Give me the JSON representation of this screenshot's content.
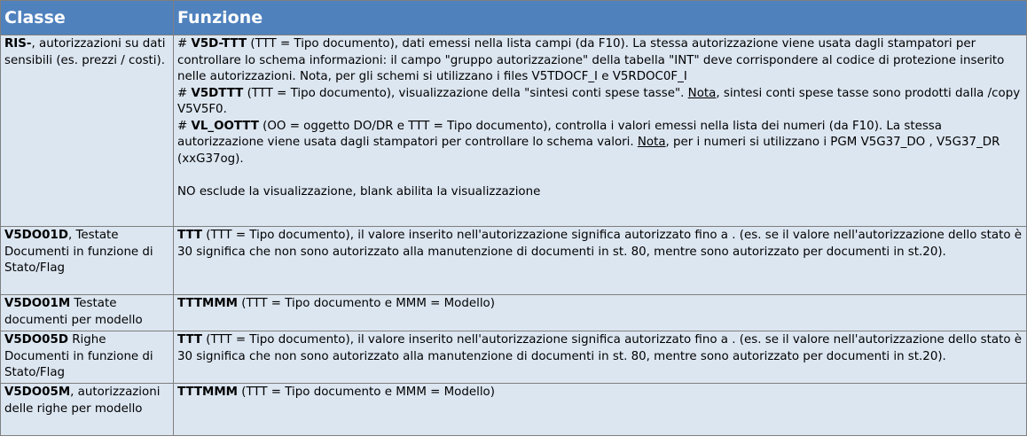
{
  "header": {
    "col_classe": "Classe",
    "col_funzione": "Funzione"
  },
  "rows": [
    {
      "classe_code": "RIS-",
      "classe_desc": ", autorizzazioni su dati sensibili (es. prezzi / costi).",
      "funzione": {
        "p1_hash": "# ",
        "p1_code": "V5D-TTT",
        "p1_text": " (TTT = Tipo documento), dati emessi nella lista campi (da F10). La stessa autorizzazione viene usata dagli stampatori per controllare lo schema informazioni: il campo \"gruppo autorizzazione\" della tabella \"INT\" deve corrispondere al codice di protezione inserito nelle autorizzazioni. Nota, per gli schemi si utilizzano i files V5TDOCF_I e V5RDOC0F_I",
        "p2_hash": "# ",
        "p2_code": "V5DTTT",
        "p2_text": " (TTT = Tipo documento), visualizzazione della \"sintesi conti spese tasse\". ",
        "p2_note": "Nota",
        "p2_text2": ", sintesi conti spese tasse sono prodotti dalla /copy V5V5F0.",
        "p3_hash": "# ",
        "p3_code": "VL_OOTTT",
        "p3_text": " (OO = oggetto  DO/DR e TTT = Tipo documento), controlla i valori emessi nella lista dei numeri (da F10). La stessa autorizzazione viene usata dagli stampatori per controllare lo schema valori. ",
        "p3_note": "Nota",
        "p3_text2": ", per i numeri si utilizzano i PGM V5G37_DO , V5G37_DR (xxG37og).",
        "p4_text": "NO esclude la visualizzazione, blank abilita la visualizzazione"
      }
    },
    {
      "classe_code": "V5DO01D",
      "classe_desc": ", Testate Documenti in funzione di Stato/Flag",
      "funzione_code": "TTT",
      "funzione_text": " (TTT = Tipo documento), il valore inserito nell'autorizzazione significa autorizzato fino a . (es. se il valore nell'autorizzazione dello stato è 30 significa che non sono autorizzato alla manutenzione di documenti in st. 80, mentre sono autorizzato per documenti in st.20)."
    },
    {
      "classe_code": "V5DO01M",
      "classe_desc": " Testate documenti per modello",
      "funzione_code": "TTTMMM",
      "funzione_text": " (TTT = Tipo documento e MMM = Modello)"
    },
    {
      "classe_code": "V5DO05D",
      "classe_desc": " Righe Documenti in funzione di Stato/Flag",
      "funzione_code": "TTT",
      "funzione_text": " (TTT = Tipo documento), il valore inserito nell'autorizzazione significa autorizzato fino a . (es. se il valore nell'autorizzazione dello stato è 30 significa che non sono autorizzato alla manutenzione di documenti in st. 80, mentre sono autorizzato per documenti in st.20)."
    },
    {
      "classe_code": "V5DO05M",
      "classe_desc": ", autorizzazioni delle righe per modello",
      "funzione_code": "TTTMMM",
      "funzione_text": " (TTT = Tipo documento e MMM = Modello)"
    }
  ]
}
